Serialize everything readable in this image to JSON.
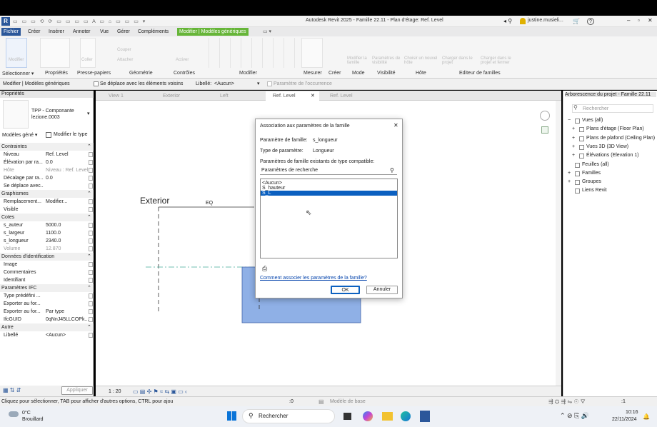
{
  "app": {
    "title": "Autodesk Revit 2025 - Famille 22.11 - Plan d'étage: Ref. Level",
    "user": "justine.musieli...",
    "help": "?",
    "qat_marker": "R"
  },
  "ribbon_tabs": [
    "Fichier",
    "Créer",
    "Insérer",
    "Annoter",
    "Vue",
    "Gérer",
    "Compléments",
    "Modifier | Modèles génériques"
  ],
  "ribbon_groups": {
    "select": "Sélectionner ▾",
    "properties": "Propriétés",
    "clipboard": "Presse-papiers",
    "geometry": "Géométrie",
    "controls": "Contrôles",
    "modify": "Modifier",
    "measure": "Mesurer",
    "create": "Créer",
    "mode": "Mode",
    "visibility": "Visibilité",
    "host": "Hôte",
    "family_editor": "Editeur de familles"
  },
  "ribbon_ghosts": {
    "modify": "Modifier",
    "paste": "Coller",
    "cut": "Couper",
    "attach": "Attacher",
    "activate": "Activer",
    "modify_family": "Modifier la famille",
    "vis_params": "Paramètres de visibilité",
    "choose_host": "Choisir un nouvel hôte",
    "load_project": "Charger dans le projet",
    "load_close": "Charger dans le projet et fermer"
  },
  "context_bar": {
    "label": "Modifier | Modèles génériques",
    "move_with_nearby": "Se déplace avec les éléments voisins",
    "libelle_label": "Libellé:",
    "libelle_value": "<Aucun>",
    "occurrence_param": "Paramètre de l'occurrence"
  },
  "properties": {
    "title": "Propriétés",
    "type_name": "TPP - Componante lezione.0003",
    "filter": "Modèles géné ▾",
    "edit_type": "Modifier le type",
    "apply": "Appliquer",
    "sections": [
      {
        "name": "Contraintes",
        "rows": [
          {
            "k": "Niveau",
            "v": "Ref. Level"
          },
          {
            "k": "Élévation par ra...",
            "v": "0.0"
          },
          {
            "k": "Hôte",
            "v": "Niveau : Ref. Level",
            "dim": true
          },
          {
            "k": "Décalage par ra...",
            "v": "0.0"
          },
          {
            "k": "Se déplace avec...",
            "v": ""
          }
        ]
      },
      {
        "name": "Graphismes",
        "rows": [
          {
            "k": "Remplacement...",
            "v": "Modifier..."
          },
          {
            "k": "Visible",
            "v": ""
          }
        ]
      },
      {
        "name": "Cotes",
        "rows": [
          {
            "k": "s_auteur",
            "v": "5000.0"
          },
          {
            "k": "s_largeur",
            "v": "1100.0"
          },
          {
            "k": "s_longueur",
            "v": "2340.0"
          },
          {
            "k": "Volume",
            "v": "12.870",
            "dim": true
          }
        ]
      },
      {
        "name": "Données d'identification",
        "rows": [
          {
            "k": "Image",
            "v": ""
          },
          {
            "k": "Commentaires",
            "v": ""
          },
          {
            "k": "Identifiant",
            "v": ""
          }
        ]
      },
      {
        "name": "Paramètres IFC",
        "rows": [
          {
            "k": "Type prédéfini ...",
            "v": ""
          },
          {
            "k": "Exporter au for...",
            "v": ""
          },
          {
            "k": "Exporter au for...",
            "v": "Par type"
          },
          {
            "k": "IfcGUID",
            "v": "0qNnJ45LLCOPk..."
          }
        ]
      },
      {
        "name": "Autre",
        "rows": [
          {
            "k": "Libellé",
            "v": "<Aucun>"
          }
        ]
      }
    ]
  },
  "view_tabs": [
    "View 1",
    "Exterior",
    "Left",
    "Ref. Level",
    "Ref. Level"
  ],
  "canvas": {
    "exterior_label": "Exterior",
    "eq_label": "EQ",
    "scale": "1 : 20"
  },
  "dialog": {
    "title": "Association aux paramètres de la famille",
    "family_param_label": "Paramètre de famille:",
    "family_param_value": "s_longueur",
    "param_type_label": "Type de paramètre:",
    "param_type_value": "Longueur",
    "existing_label": "Paramètres de famille existants de type compatible:",
    "search_placeholder": "Paramètres de recherche",
    "list": [
      "<Aucun>",
      "S_hauteur",
      "S_L"
    ],
    "selected_index": 2,
    "help_link": "Comment associer les paramètres de la famille?",
    "ok": "OK",
    "cancel": "Annuler"
  },
  "browser": {
    "title": "Arborescence du projet - Famille 22.11",
    "search_placeholder": "Rechercher",
    "items": [
      {
        "label": "Vues (all)",
        "indent": 0,
        "prefix": "−"
      },
      {
        "label": "Plans d'étage (Floor Plan)",
        "indent": 1,
        "prefix": "+"
      },
      {
        "label": "Plans de plafond (Ceiling Plan)",
        "indent": 1,
        "prefix": "+"
      },
      {
        "label": "Vues 3D (3D View)",
        "indent": 1,
        "prefix": "+"
      },
      {
        "label": "Élévations (Elevation 1)",
        "indent": 1,
        "prefix": "+"
      },
      {
        "label": "Feuilles (all)",
        "indent": 0,
        "prefix": ""
      },
      {
        "label": "Familles",
        "indent": 0,
        "prefix": "+"
      },
      {
        "label": "Groupes",
        "indent": 0,
        "prefix": "+"
      },
      {
        "label": "Liens Revit",
        "indent": 0,
        "prefix": ""
      }
    ]
  },
  "statusbar": {
    "hint": "Cliquez pour sélectionner, TAB pour afficher d'autres options, CTRL pour ajou",
    "coord": ":0",
    "base_model": "Modèle de base",
    "filter": ":1"
  },
  "taskbar": {
    "temp": "0°C",
    "weather": "Brouillard",
    "search": "Rechercher",
    "time": "10:16",
    "date": "22/11/2024"
  },
  "colors": {
    "accent": "#2b579a",
    "selection": "#0b60c0",
    "contextual_tab": "#66b538",
    "element_fill": "#8fb0e6"
  }
}
